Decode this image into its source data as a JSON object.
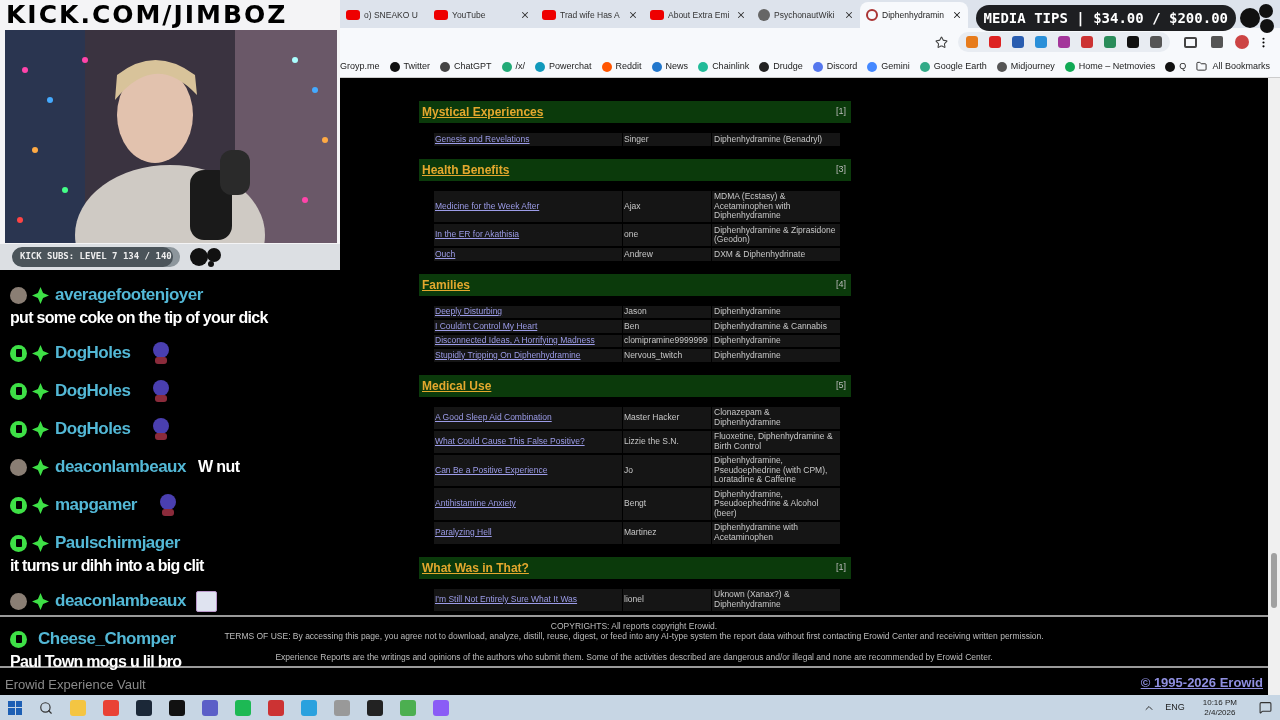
{
  "overlay": {
    "banner": "KICK.COM/JIMBOZ",
    "subs_bar": "KICK SUBS: LEVEL 7 134 / 140",
    "media_tips": "MEDIA TIPS | $34.00 / $200.00",
    "chat": [
      {
        "user": "averagefootenjoyer",
        "kind": "avatar",
        "sub_badge": true,
        "message": "put some coke on the tip of your dick",
        "inline_message": false
      },
      {
        "user": "DogHoles",
        "kind": "kick",
        "sub_badge": true,
        "emote": {
          "kind": "figure"
        }
      },
      {
        "user": "DogHoles",
        "kind": "kick",
        "sub_badge": true,
        "emote": {
          "kind": "figure"
        }
      },
      {
        "user": "DogHoles",
        "kind": "kick",
        "sub_badge": true,
        "emote": {
          "kind": "figure"
        }
      },
      {
        "user": "deaconlambeaux",
        "kind": "avatar",
        "sub_badge": true,
        "message": "W nut",
        "inline_message": true
      },
      {
        "user": "mapgamer",
        "kind": "kick",
        "sub_badge": true,
        "emote": {
          "kind": "figure"
        }
      },
      {
        "user": "Paulschirmjager",
        "kind": "kick",
        "sub_badge": true,
        "message": "it turns ur dihh into a big clit",
        "inline_message": false
      },
      {
        "user": "deaconlambeaux",
        "kind": "avatar",
        "sub_badge": true
      },
      {
        "user": "Cheese_Chomper",
        "kind": "kick",
        "sub_badge": false,
        "message": "Paul Town mogs u lil bro",
        "inline_message": false
      }
    ],
    "subs": {
      "level": 0.957
    }
  },
  "browser": {
    "tabs": [
      {
        "title": "o) SNEAKO U",
        "kind": "youtube",
        "selected": false
      },
      {
        "title": "YouTube",
        "kind": "youtube",
        "selected": false
      },
      {
        "title": "Trad wife Has A",
        "kind": "youtube",
        "selected": false
      },
      {
        "title": "About Extra Emi",
        "kind": "youtube",
        "selected": false
      },
      {
        "title": "PsychonautWiki",
        "kind": "wiki",
        "selected": false
      },
      {
        "title": "Diphenhydramin",
        "kind": "erowid",
        "selected": true
      }
    ],
    "bookmarks": [
      "Groyp.me",
      "Twitter",
      "ChatGPT",
      "/x/",
      "Powerchat",
      "Reddit",
      "News",
      "Chainlink",
      "Drudge",
      "Discord",
      "Gemini",
      "Google Earth",
      "Midjourney",
      "Home – Netmovies",
      "Q"
    ],
    "all_bookmarks": "All Bookmarks"
  },
  "page": {
    "sections": [
      {
        "title": "Mystical Experiences",
        "count": "[1]",
        "rows": [
          {
            "title": "Genesis and Revelations",
            "author": "Singer",
            "substance": "Diphenhydramine (Benadryl)"
          }
        ]
      },
      {
        "title": "Health Benefits",
        "count": "[3]",
        "rows": [
          {
            "title": "Medicine for the Week After",
            "author": "Ajax",
            "substance": "MDMA (Ecstasy) & Acetaminophen with Diphenhydramine"
          },
          {
            "title": "In the ER for Akathisia",
            "author": "one",
            "substance": "Diphenhydramine & Ziprasidone (Geodon)"
          },
          {
            "title": "Ouch",
            "author": "Andrew",
            "substance": "DXM & Diphenhydrinate"
          }
        ]
      },
      {
        "title": "Families",
        "count": "[4]",
        "rows": [
          {
            "title": "Deeply Disturbing",
            "author": "Jason",
            "substance": "Diphenhydramine"
          },
          {
            "title": "I Couldn't Control My Heart",
            "author": "Ben",
            "substance": "Diphenhydramine & Cannabis"
          },
          {
            "title": "Disconnected Ideas, A Horrifying Madness",
            "author": "clomipramine9999999",
            "substance": "Diphenhydramine"
          },
          {
            "title": "Stupidly Tripping On Diphenhydramine",
            "author": "Nervous_twitch",
            "substance": "Diphenhydramine"
          }
        ]
      },
      {
        "title": "Medical Use",
        "count": "[5]",
        "rows": [
          {
            "title": "A Good Sleep Aid Combination",
            "author": "Master Hacker",
            "substance": "Clonazepam & Diphenhydramine"
          },
          {
            "title": "What Could Cause This False Positive?",
            "author": "Lizzie the S.N.",
            "substance": "Fluoxetine, Diphenhydramine & Birth Control"
          },
          {
            "title": "Can Be a Positive Experience",
            "author": "Jo",
            "substance": "Diphenhydramine, Pseudoephedrine (with CPM), Loratadine & Caffeine"
          },
          {
            "title": "Antihistamine Anxiety",
            "author": "Bengt",
            "substance": "Diphenhydramine, Pseudoephedrine & Alcohol (beer)"
          },
          {
            "title": "Paralyzing Hell",
            "author": "Martinez",
            "substance": "Diphenhydramine with Acetaminophen"
          }
        ]
      },
      {
        "title": "What Was in That?",
        "count": "[1]",
        "rows": [
          {
            "title": "I'm Still Not Entirely Sure What It Was",
            "author": "lionel",
            "substance": "Uknown (Xanax?) & Diphenhydramine"
          }
        ]
      }
    ],
    "copyrights": "COPYRIGHTS: All reports copyright Erowid.",
    "terms": "TERMS OF USE: By accessing this page, you agree not to download, analyze, distill, reuse, digest, or feed into any AI-type system the report data without first contacting Erowid Center and receiving written permission.",
    "disclaimer": "Experience Reports are the writings and opinions of the authors who submit them. Some of the activities described are dangerous and/or illegal and none are recommended by Erowid Center.",
    "site_title": "Erowid Experience Vault",
    "copyright_link": "© 1995-2026 Erowid"
  },
  "taskbar": {
    "language": "ENG",
    "time": "10:16 PM",
    "date": "2/4/2026"
  }
}
